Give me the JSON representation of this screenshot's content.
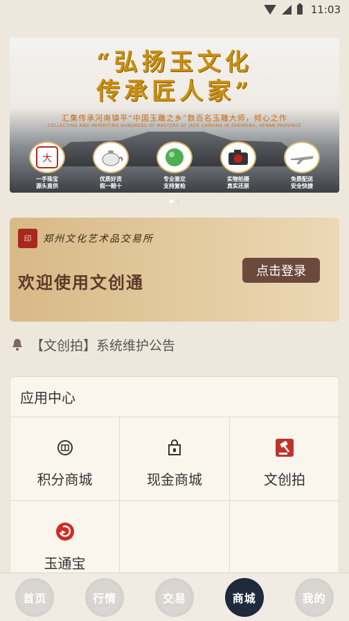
{
  "status_bar": {
    "time": "11:03"
  },
  "banner": {
    "title_line1": "“弘扬玉文化",
    "title_line2": "传承匠人家”",
    "subtitle": "汇集传承河南镇平“中国玉雕之乡”数百名玉雕大师，倾心之作",
    "subtitle_en": "COLLECTING AND INHERITING HUNDREDS OF MASTERS OF JADE CARVING IN ZHENPING, HENAN PROVINCE",
    "features": [
      {
        "icon": "logo-seal-icon",
        "text": "一手珠宝\n源头直供"
      },
      {
        "icon": "teapot-icon",
        "text": "优质好货\n假一赔十"
      },
      {
        "icon": "jade-icon",
        "text": "专业鉴定\n支持复检"
      },
      {
        "icon": "camera-icon",
        "text": "实物拍摄\n真实还原"
      },
      {
        "icon": "airplane-icon",
        "text": "免费配送\n安全快捷"
      }
    ],
    "page_count": 2,
    "active_page": 0
  },
  "login_card": {
    "org_name": "郑州文化艺术品交易所",
    "welcome": "欢迎使用文创通",
    "login_label": "点击登录"
  },
  "notice": {
    "text": "【文创拍】系统维护公告"
  },
  "app_center": {
    "title": "应用中心",
    "apps": [
      {
        "label": "积分商城",
        "icon": "points-mall-icon"
      },
      {
        "label": "现金商城",
        "icon": "shopping-bag-icon"
      },
      {
        "label": "文创拍",
        "icon": "auction-gavel-icon"
      },
      {
        "label": "玉通宝",
        "icon": "yutongbao-icon"
      },
      {
        "label": "",
        "icon": ""
      },
      {
        "label": "",
        "icon": ""
      }
    ]
  },
  "bottom_nav": {
    "items": [
      {
        "label": "首页",
        "active": false
      },
      {
        "label": "行情",
        "active": false
      },
      {
        "label": "交易",
        "active": false
      },
      {
        "label": "商城",
        "active": true
      },
      {
        "label": "我的",
        "active": false
      }
    ]
  },
  "colors": {
    "background": "#eee8dc",
    "gold_title": "#c9900f",
    "login_button": "#6b4a3c",
    "nav_active": "#1f2a3c",
    "accent_red": "#c0332b"
  }
}
